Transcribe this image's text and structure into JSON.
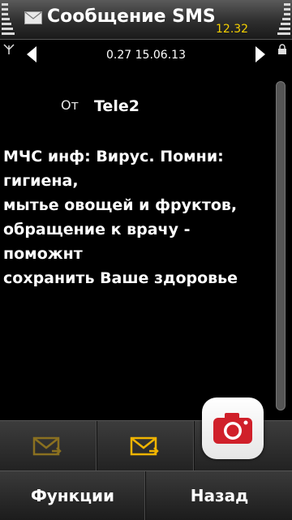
{
  "status_bar": {
    "title": "Сообщение SMS",
    "clock": "12.32",
    "title_icon": "envelope-icon"
  },
  "navigation": {
    "date": "0.27 15.06.13",
    "prev_icon": "triangle-left-icon",
    "next_icon": "triangle-right-icon"
  },
  "message": {
    "from_label": "От",
    "from_value": "Tele2",
    "lines": [
      "МЧС инф: Вирус. Помни: гигиена,",
      "мытье овощей и фруктов,",
      "обращение к врачу - поможнт",
      "сохранить Ваше здоровье"
    ]
  },
  "toolbar": {
    "reply_icon": "envelope-reply-icon",
    "forward_icon": "envelope-forward-icon",
    "camera_icon": "camera-icon"
  },
  "softkeys": {
    "left_label": "Функции",
    "right_label": "Назад"
  },
  "colors": {
    "clock": "#f5d000",
    "icon_gold": "#f0b400",
    "icon_gold_dim": "#8a7020",
    "camera_red": "#d0202a"
  }
}
